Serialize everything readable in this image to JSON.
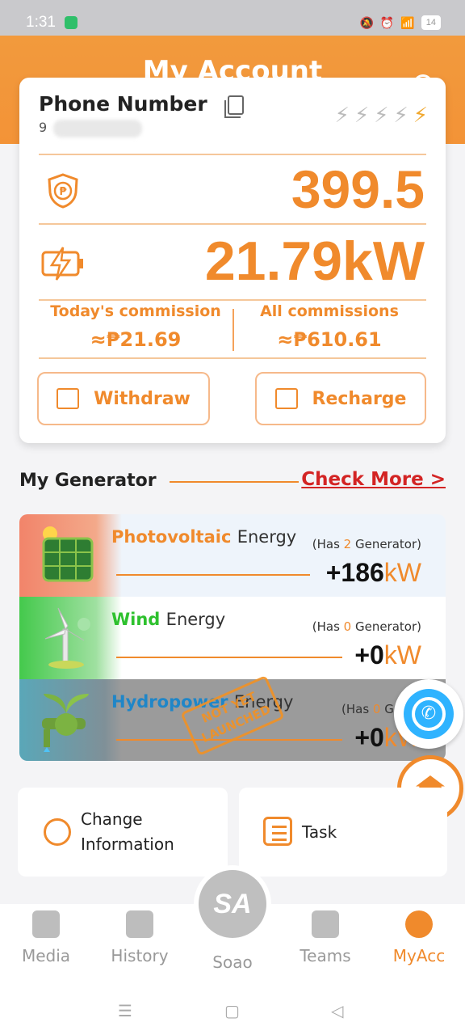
{
  "status_bar": {
    "time": "1:31",
    "battery": "14"
  },
  "header": {
    "title": "My Account"
  },
  "account": {
    "phone_label": "Phone Number",
    "phone_prefix": "9",
    "balance": "399.5",
    "power": "21.79kW",
    "level_icons": [
      "bolt-icon",
      "bolt-icon",
      "bolt-icon",
      "bolt-icon",
      "bolt-icon-active"
    ],
    "commissions": {
      "today_label": "Today's commission",
      "today_value": "≈₱21.69",
      "all_label": "All commissions",
      "all_value": "≈₱610.61"
    },
    "buttons": {
      "withdraw": "Withdraw",
      "recharge": "Recharge"
    }
  },
  "generator": {
    "title": "My Generator",
    "check_more": "Check More >",
    "rows": [
      {
        "type": "Photovoltaic",
        "suffix": "Energy",
        "has_prefix": "(Has ",
        "count": "2",
        "has_suffix": " Generator)",
        "power": "+186",
        "unit": "kW",
        "type_color": "#f08a2c"
      },
      {
        "type": "Wind",
        "suffix": "Energy",
        "has_prefix": "(Has ",
        "count": "0",
        "has_suffix": " Generator)",
        "power": "+0",
        "unit": "kW",
        "type_color": "#2ec12e"
      },
      {
        "type": "Hydropower",
        "suffix": "Energy",
        "has_prefix": "(Has ",
        "count": "0",
        "has_suffix": " Gener",
        "power": "+0",
        "unit": "kW",
        "type_color": "#1f86c8"
      }
    ],
    "stamp": "NOT YET LAUNCHED"
  },
  "tiles": {
    "change_info": "Change Information",
    "task": "Task"
  },
  "nav": {
    "media": "Media",
    "history": "History",
    "center_logo": "SA",
    "center_label": "Soao",
    "teams": "Teams",
    "myacc": "MyAcc"
  },
  "colors": {
    "accent": "#f08a2c",
    "danger": "#d32424"
  }
}
